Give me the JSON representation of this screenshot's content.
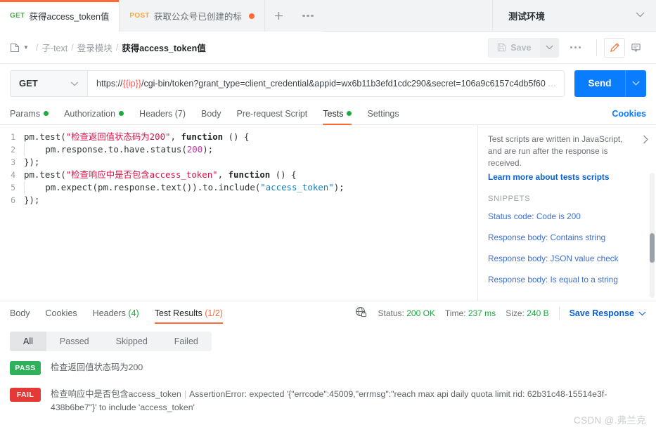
{
  "tabbar": {
    "tabs": [
      {
        "method": "GET",
        "name": "获得access_token值",
        "active": true,
        "unsaved": false
      },
      {
        "method": "POST",
        "name": "获取公众号已创建的标",
        "active": false,
        "unsaved": true
      }
    ],
    "new_tab_label": "+",
    "more_label": "more-options",
    "environment": "测试环境"
  },
  "breadcrumb": {
    "items": [
      {
        "label": "子-text",
        "current": false
      },
      {
        "label": "登录模块",
        "current": false
      },
      {
        "label": "获得access_token值",
        "current": true
      }
    ],
    "separator": "/",
    "save_label": "Save",
    "save_caret": "⌄",
    "more": "…"
  },
  "request": {
    "method": "GET",
    "url_prefix": "https://",
    "url_variable": "{{ip}}",
    "url_rest": "/cgi-bin/token?grant_type=client_credential&appid=wx6b11b3efd1cdc290&secret=106a9c6157c4db5f60",
    "url_ellipsis": "…",
    "send_label": "Send",
    "tabs": [
      {
        "label": "Params",
        "dot": true,
        "active": false
      },
      {
        "label": "Authorization",
        "dot": true,
        "active": false
      },
      {
        "label": "Headers (7)",
        "dot": false,
        "active": false
      },
      {
        "label": "Body",
        "dot": false,
        "active": false
      },
      {
        "label": "Pre-request Script",
        "dot": false,
        "active": false
      },
      {
        "label": "Tests",
        "dot": true,
        "active": true
      },
      {
        "label": "Settings",
        "dot": false,
        "active": false
      }
    ],
    "cookies_link": "Cookies"
  },
  "editor": {
    "lines": [
      {
        "n": "1",
        "indent": 0,
        "parts": [
          {
            "t": "pm.test(",
            "c": "pun"
          },
          {
            "t": "\"检查返回值状态码为200\"",
            "c": "str-red"
          },
          {
            "t": ", ",
            "c": "pun"
          },
          {
            "t": "function",
            "c": "kw"
          },
          {
            "t": " () {",
            "c": "pun"
          }
        ]
      },
      {
        "n": "2",
        "indent": 1,
        "parts": [
          {
            "t": "pm.response.to.have.status(",
            "c": "pun"
          },
          {
            "t": "200",
            "c": "num"
          },
          {
            "t": ");",
            "c": "pun"
          }
        ]
      },
      {
        "n": "3",
        "indent": 0,
        "parts": [
          {
            "t": "});",
            "c": "pun"
          }
        ]
      },
      {
        "n": "4",
        "indent": 0,
        "parts": [
          {
            "t": "pm.test(",
            "c": "pun"
          },
          {
            "t": "\"检查响应中是否包含access_token\"",
            "c": "str-red"
          },
          {
            "t": ", ",
            "c": "pun"
          },
          {
            "t": "function",
            "c": "kw"
          },
          {
            "t": " () {",
            "c": "pun"
          }
        ]
      },
      {
        "n": "5",
        "indent": 1,
        "parts": [
          {
            "t": "pm.expect(pm.response.text()).to.include(",
            "c": "pun"
          },
          {
            "t": "\"access_token\"",
            "c": "str"
          },
          {
            "t": ");",
            "c": "pun"
          }
        ]
      },
      {
        "n": "6",
        "indent": 0,
        "parts": [
          {
            "t": "});",
            "c": "pun"
          }
        ]
      }
    ]
  },
  "snippets": {
    "intro": "Test scripts are written in JavaScript, and are run after the response is received.",
    "learn_more": "Learn more about tests scripts",
    "heading": "SNIPPETS",
    "items": [
      "Status code: Code is 200",
      "Response body: Contains string",
      "Response body: JSON value check",
      "Response body: Is equal to a string"
    ]
  },
  "response": {
    "tabs": [
      {
        "label": "Body",
        "count": "",
        "count_color": "",
        "active": false
      },
      {
        "label": "Cookies",
        "count": "",
        "count_color": "",
        "active": false
      },
      {
        "label": "Headers",
        "count": "(4)",
        "count_color": "green",
        "active": false
      },
      {
        "label": "Test Results",
        "count": "(1/2)",
        "count_color": "orange",
        "active": true
      }
    ],
    "status_label": "Status:",
    "status_value": "200 OK",
    "time_label": "Time:",
    "time_value": "237 ms",
    "size_label": "Size:",
    "size_value": "240 B",
    "save_response": "Save Response",
    "save_response_caret": "⌄",
    "filters": [
      {
        "label": "All",
        "active": true
      },
      {
        "label": "Passed",
        "active": false
      },
      {
        "label": "Skipped",
        "active": false
      },
      {
        "label": "Failed",
        "active": false
      }
    ],
    "results": [
      {
        "status": "PASS",
        "name": "检查返回值状态码为200",
        "message": ""
      },
      {
        "status": "FAIL",
        "name": "检查响应中是否包含access_token",
        "message": "AssertionError: expected '{\"errcode\":45009,\"errmsg\":\"reach max api daily quota limit rid: 62b31c48-15514e3f-438b6be7\"}' to include 'access_token'"
      }
    ]
  },
  "watermark": "CSDN @.弗兰克",
  "colors": {
    "accent": "#ff6c37",
    "send": "#0a7cff",
    "pass": "#2eb15a",
    "fail": "#e53935",
    "link": "#0a5fd4",
    "get": "#4fae4f",
    "post": "#f4a93d"
  }
}
